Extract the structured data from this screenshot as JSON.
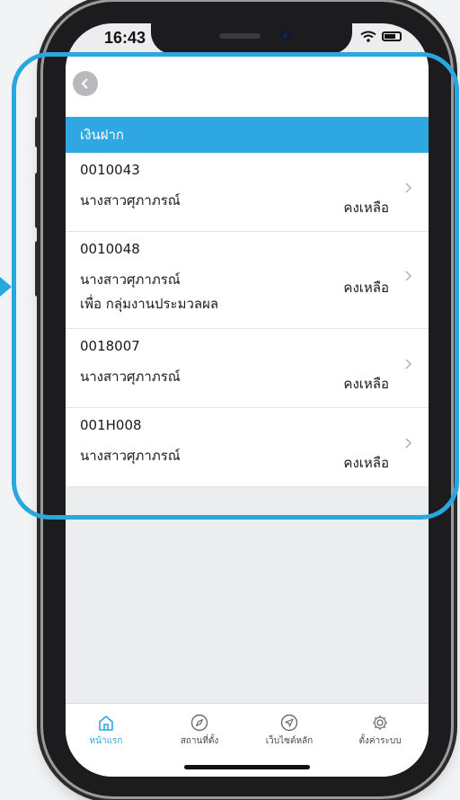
{
  "status_bar": {
    "time": "16:43"
  },
  "header": {
    "section_title": "เงินฝาก"
  },
  "accounts": [
    {
      "number": "0010043",
      "name": "นางสาวศุภาภรณ์",
      "subtitle": "",
      "balance_label": "คงเหลือ"
    },
    {
      "number": "0010048",
      "name": "นางสาวศุภาภรณ์",
      "subtitle": "เพื่อ กลุ่มงานประมวลผล",
      "balance_label": "คงเหลือ"
    },
    {
      "number": "0018007",
      "name": "นางสาวศุภาภรณ์",
      "subtitle": "",
      "balance_label": "คงเหลือ"
    },
    {
      "number": "001H008",
      "name": "นางสาวศุภาภรณ์",
      "subtitle": "",
      "balance_label": "คงเหลือ"
    }
  ],
  "tabbar": {
    "items": [
      {
        "label": "หน้าแรก",
        "icon": "home-icon",
        "active": true
      },
      {
        "label": "สถานที่ตั้ง",
        "icon": "compass-icon",
        "active": false
      },
      {
        "label": "เว็บไซต์หลัก",
        "icon": "navigate-arrow-icon",
        "active": false
      },
      {
        "label": "ตั้งค่าระบบ",
        "icon": "gear-icon",
        "active": false
      }
    ]
  },
  "colors": {
    "accent": "#2fa7e3",
    "highlight_outline": "#29a8e0",
    "back_button": "#b7b9bc"
  }
}
